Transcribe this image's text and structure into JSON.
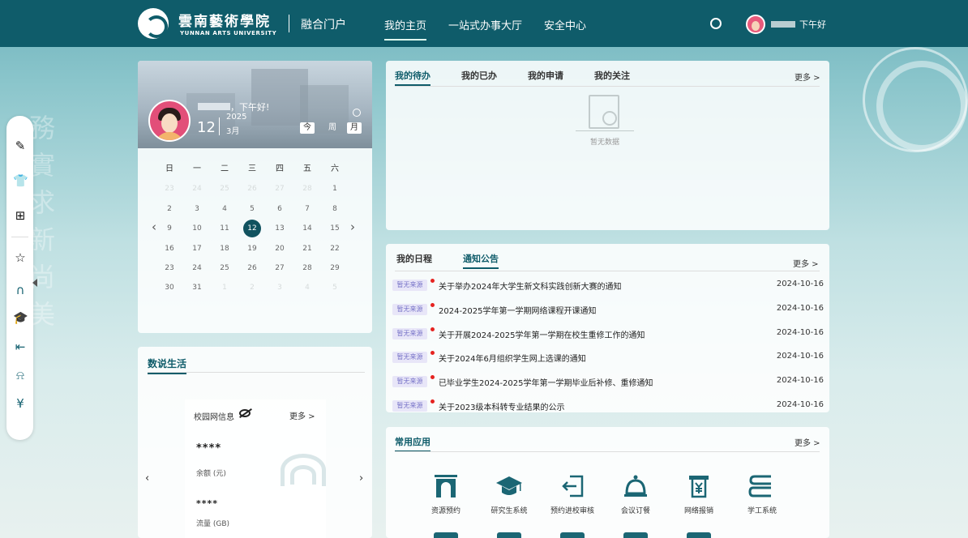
{
  "header": {
    "logo_cn": "雲南藝術學院",
    "logo_en": "YUNNAN ARTS UNIVERSITY",
    "portal": "融合门户",
    "nav": [
      "我的主页",
      "一站式办事大厅",
      "安全中心"
    ],
    "greeting": "下午好"
  },
  "calendar": {
    "greeting": "，下午好!",
    "day": "12",
    "year": "2025",
    "month": "3月",
    "views": [
      "今",
      "周",
      "月"
    ],
    "weekdays": [
      "日",
      "一",
      "二",
      "三",
      "四",
      "五",
      "六"
    ],
    "weeks": [
      [
        "23",
        "24",
        "25",
        "26",
        "27",
        "28",
        "1"
      ],
      [
        "2",
        "3",
        "4",
        "5",
        "6",
        "7",
        "8"
      ],
      [
        "9",
        "10",
        "11",
        "12",
        "13",
        "14",
        "15"
      ],
      [
        "16",
        "17",
        "18",
        "19",
        "20",
        "21",
        "22"
      ],
      [
        "23",
        "24",
        "25",
        "26",
        "27",
        "28",
        "29"
      ],
      [
        "30",
        "31",
        "1",
        "2",
        "3",
        "4",
        "5"
      ]
    ],
    "today": "12"
  },
  "life": {
    "title": "数说生活",
    "network_label": "校园网信息",
    "more": "更多 >",
    "balance_value": "****",
    "balance_label": "余额 (元)",
    "flow_value": "****",
    "flow_label": "流量 (GB)"
  },
  "todo": {
    "tabs": [
      "我的待办",
      "我的已办",
      "我的申请",
      "我的关注"
    ],
    "more": "更多 >",
    "empty": "暂无数据"
  },
  "notices": {
    "tabs": [
      "我的日程",
      "通知公告"
    ],
    "more": "更多 >",
    "items": [
      {
        "tag": "暂无来源",
        "title": "关于举办2024年大学生新文科实践创新大赛的通知",
        "date": "2024-10-16"
      },
      {
        "tag": "暂无来源",
        "title": "2024-2025学年第一学期网络课程开课通知",
        "date": "2024-10-16"
      },
      {
        "tag": "暂无来源",
        "title": "关于开展2024-2025学年第一学期在校生重修工作的通知",
        "date": "2024-10-16"
      },
      {
        "tag": "暂无来源",
        "title": "关于2024年6月组织学生网上选课的通知",
        "date": "2024-10-16"
      },
      {
        "tag": "暂无来源",
        "title": "已毕业学生2024-2025学年第一学期毕业后补修、重修通知",
        "date": "2024-10-16"
      },
      {
        "tag": "暂无来源",
        "title": "关于2023级本科转专业结果的公示",
        "date": "2024-10-16"
      }
    ]
  },
  "apps": {
    "title": "常用应用",
    "more": "更多 >",
    "items": [
      {
        "label": "资源预约",
        "icon": "arch-icon"
      },
      {
        "label": "研究生系统",
        "icon": "graduation-cap-icon"
      },
      {
        "label": "预约进校审核",
        "icon": "enter-icon"
      },
      {
        "label": "会议订餐",
        "icon": "bell-icon"
      },
      {
        "label": "网络报销",
        "icon": "receipt-icon"
      },
      {
        "label": "学工系统",
        "icon": "books-icon"
      }
    ]
  },
  "sidebar": {
    "icons": [
      "edit-icon",
      "shirt-icon",
      "add-icon",
      "star-icon",
      "arch-icon",
      "graduation-cap-icon",
      "enter-icon",
      "bell-icon",
      "receipt-icon"
    ]
  },
  "colors": {
    "primary": "#0f5c6a",
    "alert_dot": "#e52320",
    "tag_text": "#7a76c9"
  }
}
